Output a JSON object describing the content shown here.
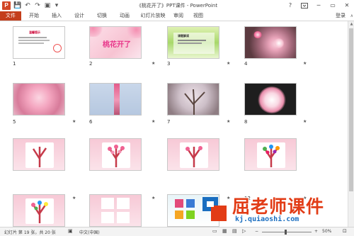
{
  "window": {
    "title": "《桃花开了》PPT课件 - PowerPoint",
    "help_icon": "?",
    "minimize_icon": "─",
    "restore_icon": "▭",
    "close_icon": "✕"
  },
  "app_icon": "P",
  "qat": {
    "save_icon": "💾",
    "undo_icon": "↶",
    "redo_icon": "↷",
    "present_icon": "▣",
    "customize_icon": "▾"
  },
  "ribbon": {
    "tabs": [
      "文件",
      "开始",
      "插入",
      "设计",
      "切换",
      "动画",
      "幻灯片放映",
      "审阅",
      "视图"
    ],
    "login": "登录"
  },
  "slides": [
    {
      "number": "1",
      "title": "温馨提示",
      "star": ""
    },
    {
      "number": "2",
      "title": "桃花开了",
      "star": "★"
    },
    {
      "number": "3",
      "title": "课题解读",
      "star": "★"
    },
    {
      "number": "4",
      "title": "",
      "star": "★"
    },
    {
      "number": "5",
      "title": "",
      "star": "★"
    },
    {
      "number": "6",
      "title": "",
      "star": "★"
    },
    {
      "number": "7",
      "title": "",
      "star": "★"
    },
    {
      "number": "8",
      "title": "",
      "star": "★"
    },
    {
      "number": "9",
      "title": "",
      "star": "★"
    },
    {
      "number": "10",
      "title": "",
      "star": "★"
    },
    {
      "number": "11",
      "title": "",
      "star": "★"
    },
    {
      "number": "12",
      "title": "",
      "star": "★"
    }
  ],
  "statusbar": {
    "slide_info": "幻灯片 第 19 张，共 20 张",
    "language": "中文(中国)",
    "zoom": "50%"
  },
  "watermark": {
    "title": "屈老师课件",
    "url": "kj.quiaoshi.com"
  },
  "colors": {
    "file_tab": "#c43e1c",
    "pink": "#f7c8d4",
    "accent_red": "#e23c16",
    "accent_blue": "#1a6ec0"
  }
}
